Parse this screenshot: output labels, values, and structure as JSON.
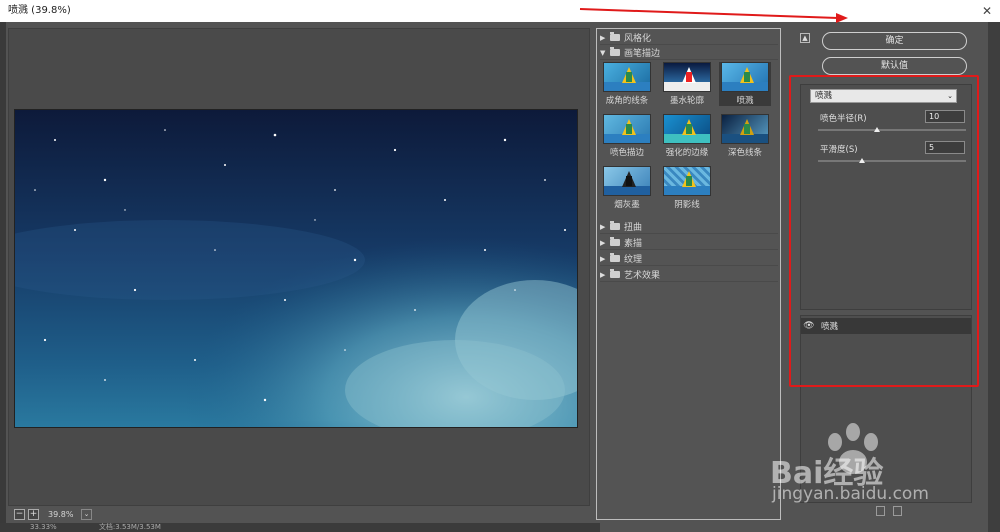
{
  "window": {
    "title": "喷溅 (39.8%)"
  },
  "preview": {
    "zoom": "39.8%"
  },
  "statusbar": {
    "left": "33.33%",
    "doc": "文档:3.53M/3.53M"
  },
  "gallery": {
    "categories_top": [
      {
        "label": "风格化",
        "expanded": false
      },
      {
        "label": "画笔描边",
        "expanded": true
      }
    ],
    "thumbnails": [
      {
        "label": "成角的线条"
      },
      {
        "label": "墨水轮廓"
      },
      {
        "label": "喷溅"
      },
      {
        "label": "喷色描边"
      },
      {
        "label": "强化的边缘"
      },
      {
        "label": "深色线条"
      },
      {
        "label": "烟灰墨"
      },
      {
        "label": "阴影线"
      }
    ],
    "selected": "喷溅",
    "categories_bottom": [
      {
        "label": "扭曲"
      },
      {
        "label": "素描"
      },
      {
        "label": "纹理"
      },
      {
        "label": "艺术效果"
      }
    ]
  },
  "buttons": {
    "ok": "确定",
    "default": "默认值"
  },
  "settings": {
    "filter": "喷溅",
    "params": [
      {
        "label": "喷色半径(R)",
        "value": "10",
        "slider": 0.4
      },
      {
        "label": "平滑度(S)",
        "value": "5",
        "slider": 0.3
      }
    ]
  },
  "layers": {
    "active": "喷溅"
  },
  "watermark": {
    "brand": "Bai经验",
    "url": "jingyan.baidu.com"
  },
  "colors": {
    "annotation": "#e01a1a",
    "panel": "#535353"
  }
}
